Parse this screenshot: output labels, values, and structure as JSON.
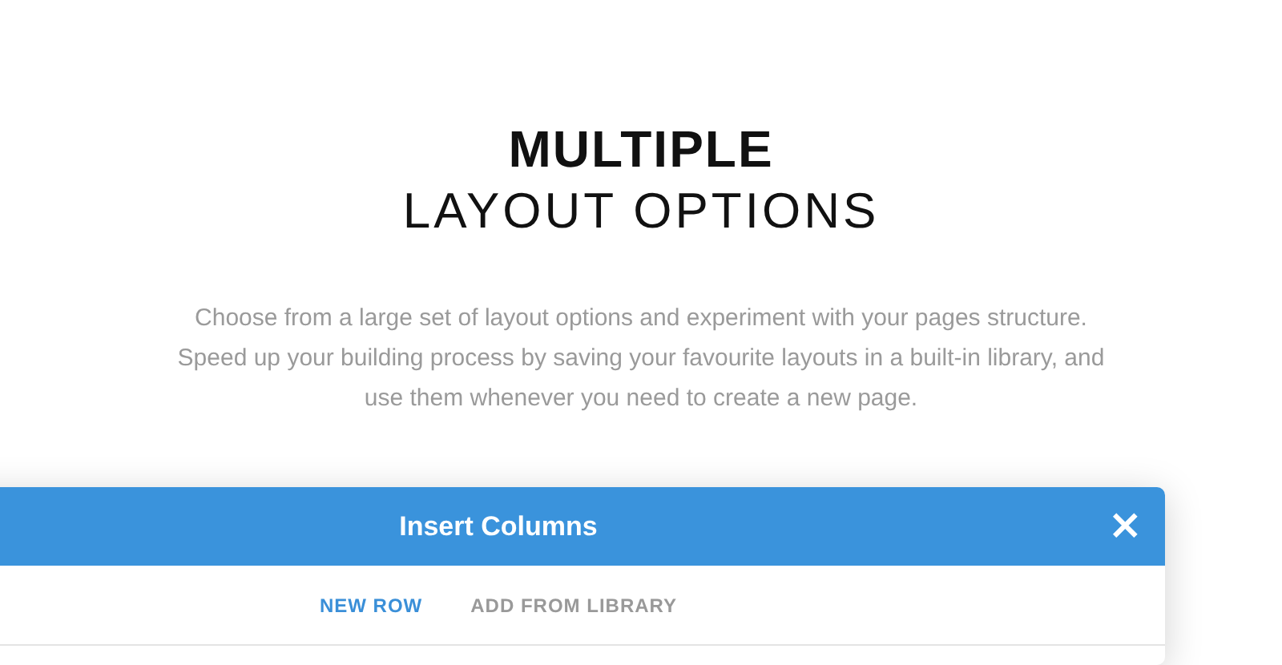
{
  "heading": {
    "title_bold": "MULTIPLE",
    "title_light": "LAYOUT OPTIONS"
  },
  "description": "Choose from a large set of layout options and experiment with your pages structure. Speed up your building process by saving your favourite layouts in a built-in library, and use them whenever you need to create a new page.",
  "dialog": {
    "title": "Insert Columns",
    "close": "×",
    "tabs": [
      {
        "label": "NEW ROW",
        "selected": true
      },
      {
        "label": "ADD FROM LIBRARY",
        "selected": false
      }
    ]
  }
}
